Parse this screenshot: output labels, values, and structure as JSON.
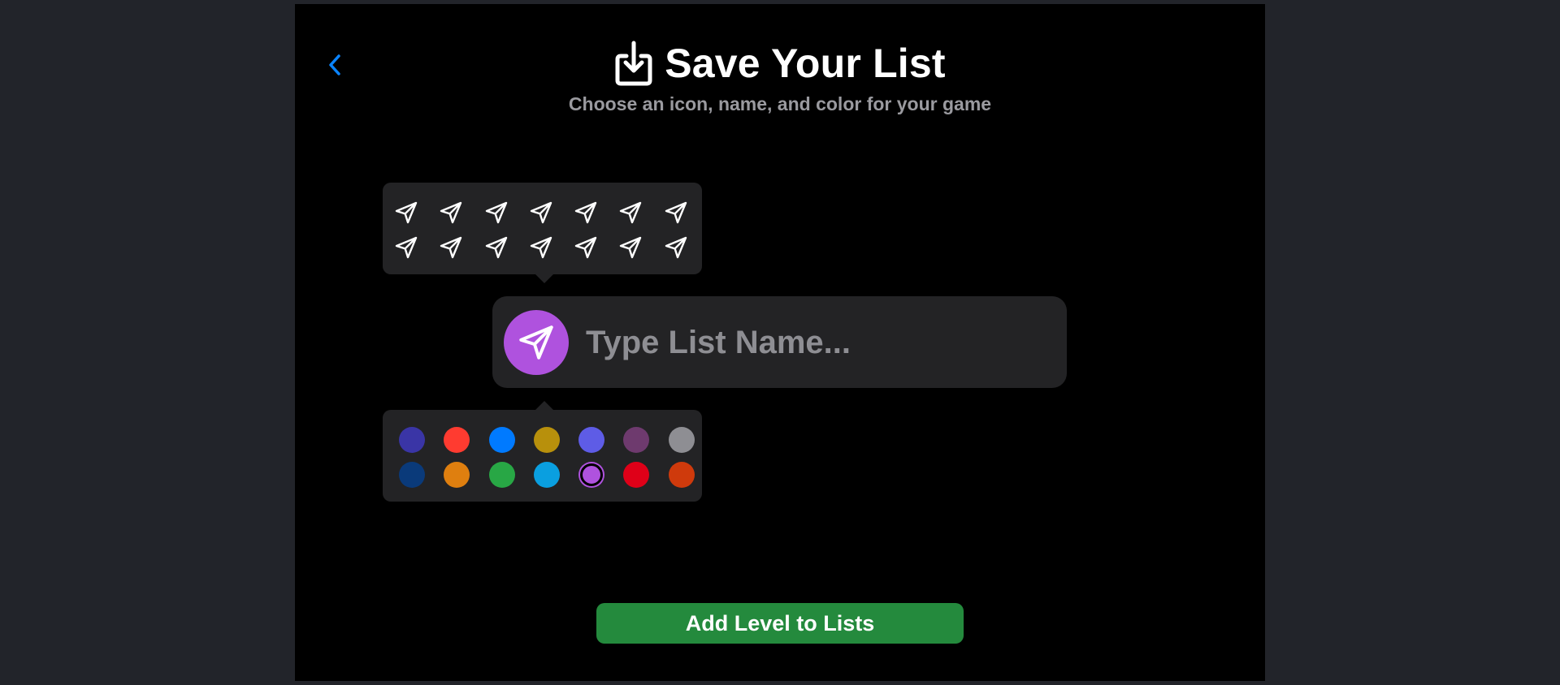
{
  "header": {
    "title": "Save Your List",
    "subtitle": "Choose an icon, name, and color for your game",
    "title_icon": "square-and-arrow-down-icon",
    "back_icon": "chevron-left-icon"
  },
  "icon_picker": {
    "icon_name": "paperplane-icon",
    "icons": [
      "paperplane-icon",
      "paperplane-icon",
      "paperplane-icon",
      "paperplane-icon",
      "paperplane-icon",
      "paperplane-icon",
      "paperplane-icon",
      "paperplane-icon",
      "paperplane-icon",
      "paperplane-icon",
      "paperplane-icon",
      "paperplane-icon",
      "paperplane-icon",
      "paperplane-icon"
    ]
  },
  "name_field": {
    "placeholder": "Type List Name...",
    "value": "",
    "selected_icon": "paperplane-icon",
    "selected_color": "#af52de"
  },
  "color_picker": {
    "colors": [
      "#3a35a6",
      "#ff3b30",
      "#007aff",
      "#b8900c",
      "#5e5ce6",
      "#6e3a6e",
      "#8e8e93",
      "#0a3a7a",
      "#df7f0f",
      "#28a745",
      "#0a9fe0",
      "#af52de",
      "#df0018",
      "#cf3a0c"
    ],
    "selected_index": 11
  },
  "actions": {
    "add_label": "Add Level to Lists"
  },
  "colors": {
    "accent_blue": "#0a84ff",
    "background": "#000000",
    "panel": "#232325",
    "button_green": "#248a3d"
  }
}
